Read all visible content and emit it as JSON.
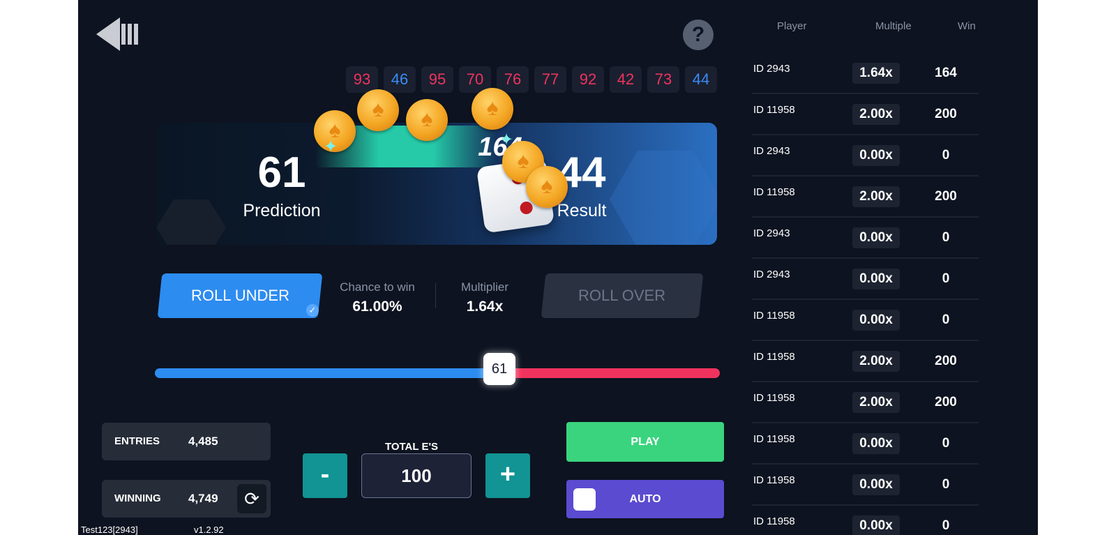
{
  "history": [
    {
      "value": "93",
      "color": "red"
    },
    {
      "value": "46",
      "color": "blue"
    },
    {
      "value": "95",
      "color": "red"
    },
    {
      "value": "70",
      "color": "red"
    },
    {
      "value": "76",
      "color": "red"
    },
    {
      "value": "77",
      "color": "red"
    },
    {
      "value": "92",
      "color": "red"
    },
    {
      "value": "42",
      "color": "red"
    },
    {
      "value": "73",
      "color": "red"
    },
    {
      "value": "44",
      "color": "blue"
    }
  ],
  "panel": {
    "prediction_value": "61",
    "prediction_label": "Prediction",
    "result_value": "44",
    "result_label": "Result",
    "win_amount": "164"
  },
  "mode": {
    "roll_under_label": "ROLL UNDER",
    "roll_over_label": "ROLL OVER",
    "selected": "roll_under",
    "chance_label": "Chance to win",
    "chance_value": "61.00%",
    "multiplier_label": "Multiplier",
    "multiplier_value": "1.64x"
  },
  "slider": {
    "value": 61,
    "min": 0,
    "max": 100,
    "value_label": "61"
  },
  "stats": {
    "entries_label": "ENTRIES",
    "entries_value": "4,485",
    "winning_label": "WINNING",
    "winning_value": "4,749"
  },
  "bet": {
    "total_label": "TOTAL E'S",
    "amount": "100",
    "minus_label": "-",
    "plus_label": "+"
  },
  "actions": {
    "play_label": "PLAY",
    "auto_label": "AUTO"
  },
  "footer": {
    "user": "Test123[2943]",
    "version": "v1.2.92"
  },
  "bets_table": {
    "headers": {
      "player": "Player",
      "multiple": "Multiple",
      "win": "Win"
    },
    "rows": [
      {
        "player": "ID 2943",
        "multiple": "1.64x",
        "win": "164"
      },
      {
        "player": "ID 11958",
        "multiple": "2.00x",
        "win": "200"
      },
      {
        "player": "ID 2943",
        "multiple": "0.00x",
        "win": "0"
      },
      {
        "player": "ID 11958",
        "multiple": "2.00x",
        "win": "200"
      },
      {
        "player": "ID 2943",
        "multiple": "0.00x",
        "win": "0"
      },
      {
        "player": "ID 2943",
        "multiple": "0.00x",
        "win": "0"
      },
      {
        "player": "ID 11958",
        "multiple": "0.00x",
        "win": "0"
      },
      {
        "player": "ID 11958",
        "multiple": "2.00x",
        "win": "200"
      },
      {
        "player": "ID 11958",
        "multiple": "2.00x",
        "win": "200"
      },
      {
        "player": "ID 11958",
        "multiple": "0.00x",
        "win": "0"
      },
      {
        "player": "ID 11958",
        "multiple": "0.00x",
        "win": "0"
      },
      {
        "player": "ID 11958",
        "multiple": "0.00x",
        "win": "0"
      }
    ]
  },
  "colors": {
    "background": "#0d1320",
    "roll_under": "#2d8cf0",
    "roll_over_track": "#f0335e",
    "play": "#3ad47e",
    "auto": "#5b4bd0",
    "stepper": "#119493"
  },
  "icons": {
    "back": "back-arrow-icon",
    "help": "question-icon",
    "refresh": "refresh-icon",
    "check": "check-icon",
    "coin": "spade-coin-icon"
  }
}
